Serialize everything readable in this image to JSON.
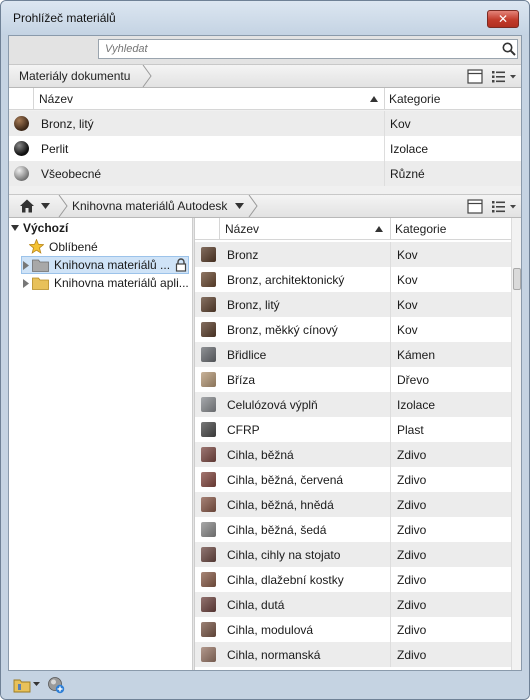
{
  "window": {
    "title": "Prohlížeč materiálů",
    "close_label": "✕"
  },
  "search": {
    "placeholder": "Vyhledat"
  },
  "document_section": {
    "breadcrumb": "Materiály dokumentu",
    "columns": {
      "name": "Název",
      "category": "Kategorie"
    },
    "rows": [
      {
        "name": "Bronz, litý",
        "category": "Kov",
        "swatch": "sphere-bronze"
      },
      {
        "name": "Perlit",
        "category": "Izolace",
        "swatch": "sphere-dark"
      },
      {
        "name": "Všeobecné",
        "category": "Různé",
        "swatch": "sphere-grey"
      }
    ]
  },
  "library_section": {
    "breadcrumb": "Knihovna materiálů Autodesk",
    "tree": {
      "root": "Výchozí",
      "items": [
        {
          "label": "Oblíbené"
        },
        {
          "label": "Knihovna materiálů ..."
        },
        {
          "label": "Knihovna materiálů apli..."
        }
      ]
    },
    "columns": {
      "name": "Název",
      "category": "Kategorie"
    },
    "rows": [
      {
        "name": "Bronz",
        "category": "Kov",
        "color": "#5a3d2a"
      },
      {
        "name": "Bronz, architektonický",
        "category": "Kov",
        "color": "#6b4a32"
      },
      {
        "name": "Bronz, litý",
        "category": "Kov",
        "color": "#5f4330"
      },
      {
        "name": "Bronz, měkký cínový",
        "category": "Kov",
        "color": "#5c3f2c"
      },
      {
        "name": "Břidlice",
        "category": "Kámen",
        "color": "#6b6e73"
      },
      {
        "name": "Bříza",
        "category": "Dřevo",
        "color": "#b79a78"
      },
      {
        "name": "Celulózová výplň",
        "category": "Izolace",
        "color": "#8a8d91"
      },
      {
        "name": "CFRP",
        "category": "Plast",
        "color": "#4b4b4b"
      },
      {
        "name": "Cihla, běžná",
        "category": "Zdivo",
        "color": "#7d4a44"
      },
      {
        "name": "Cihla, běžná, červená",
        "category": "Zdivo",
        "color": "#864a42"
      },
      {
        "name": "Cihla, běžná, hnědá",
        "category": "Zdivo",
        "color": "#8a5a4a"
      },
      {
        "name": "Cihla, běžná, šedá",
        "category": "Zdivo",
        "color": "#8c8c8c"
      },
      {
        "name": "Cihla, cihly na stojato",
        "category": "Zdivo",
        "color": "#6d4a44"
      },
      {
        "name": "Cihla, dlažební kostky",
        "category": "Zdivo",
        "color": "#8b5e4a"
      },
      {
        "name": "Cihla, dutá",
        "category": "Zdivo",
        "color": "#6e4440"
      },
      {
        "name": "Cihla, modulová",
        "category": "Zdivo",
        "color": "#7b5848"
      },
      {
        "name": "Cihla, normanská",
        "category": "Zdivo",
        "color": "#9a7868"
      }
    ]
  },
  "colors": {
    "window_frame": "#c5d3e2",
    "close_red": "#c23b2b",
    "row_alt": "#ececec",
    "selection": "#cfe3f7",
    "folder": "#e8c15a"
  },
  "icons": [
    "search-icon",
    "home-icon",
    "list-view-icon",
    "grid-view-icon",
    "star-icon",
    "folder-icon",
    "lock-icon",
    "add-material-icon",
    "library-icon"
  ]
}
